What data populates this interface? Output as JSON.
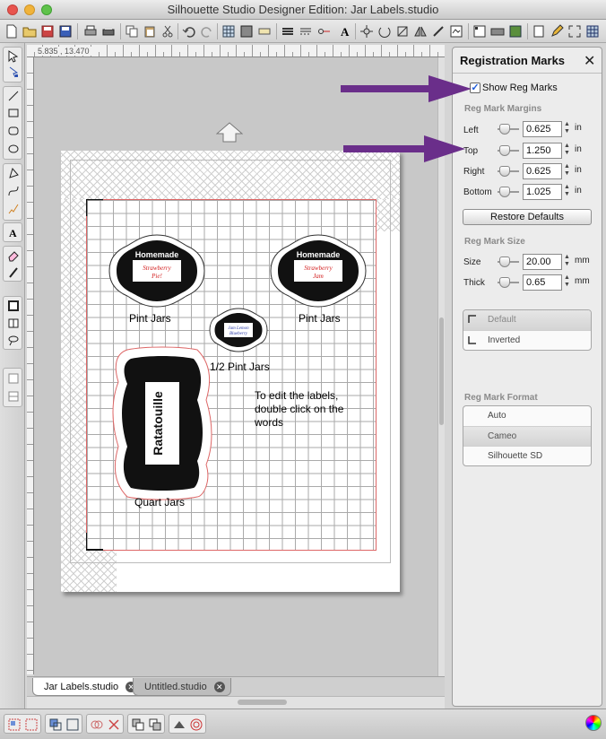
{
  "window": {
    "title": "Silhouette Studio Designer Edition: Jar Labels.studio"
  },
  "ruler": {
    "coords": "5.835 , 13.470"
  },
  "canvas": {
    "labels": {
      "pint_left": "Pint Jars",
      "pint_right": "Pint Jars",
      "half_pint": "1/2 Pint Jars",
      "quart": "Quart Jars",
      "instructions_line1": "To edit the labels,",
      "instructions_line2": "double click on the",
      "instructions_line3": "words"
    },
    "badges": {
      "homemade_1": "Homemade",
      "flavor_1_a": "Strawberry",
      "flavor_1_b": "Pie!",
      "homemade_2": "Homemade",
      "flavor_2_a": "Strawberry",
      "flavor_2_b": "Jam",
      "small_a": "Jam Lemon",
      "small_b": "Blueberry",
      "quart_word": "Ratatouille"
    }
  },
  "tabs": [
    {
      "label": "Jar Labels.studio",
      "active": true
    },
    {
      "label": "Untitled.studio",
      "active": false
    }
  ],
  "panel": {
    "title": "Registration Marks",
    "show_reg_marks_label": "Show Reg Marks",
    "show_reg_marks_checked": true,
    "margins_heading": "Reg Mark Margins",
    "margins": [
      {
        "label": "Left",
        "value": "0.625",
        "unit": "in"
      },
      {
        "label": "Top",
        "value": "1.250",
        "unit": "in"
      },
      {
        "label": "Right",
        "value": "0.625",
        "unit": "in"
      },
      {
        "label": "Bottom",
        "value": "1.025",
        "unit": "in"
      }
    ],
    "restore_label": "Restore Defaults",
    "size_heading": "Reg Mark Size",
    "size": [
      {
        "label": "Size",
        "value": "20.00",
        "unit": "mm"
      },
      {
        "label": "Thick",
        "value": "0.65",
        "unit": "mm"
      }
    ],
    "style_options": [
      {
        "label": "Default",
        "selected": true
      },
      {
        "label": "Inverted",
        "selected": false
      }
    ],
    "format_heading": "Reg Mark Format",
    "format_options": [
      {
        "label": "Auto",
        "selected": false
      },
      {
        "label": "Cameo",
        "selected": true
      },
      {
        "label": "Silhouette SD",
        "selected": false
      }
    ]
  },
  "colors": {
    "annotation_arrow": "#6a2e8a",
    "reg_border": "#dd6666",
    "label_red": "#d21c1c"
  }
}
